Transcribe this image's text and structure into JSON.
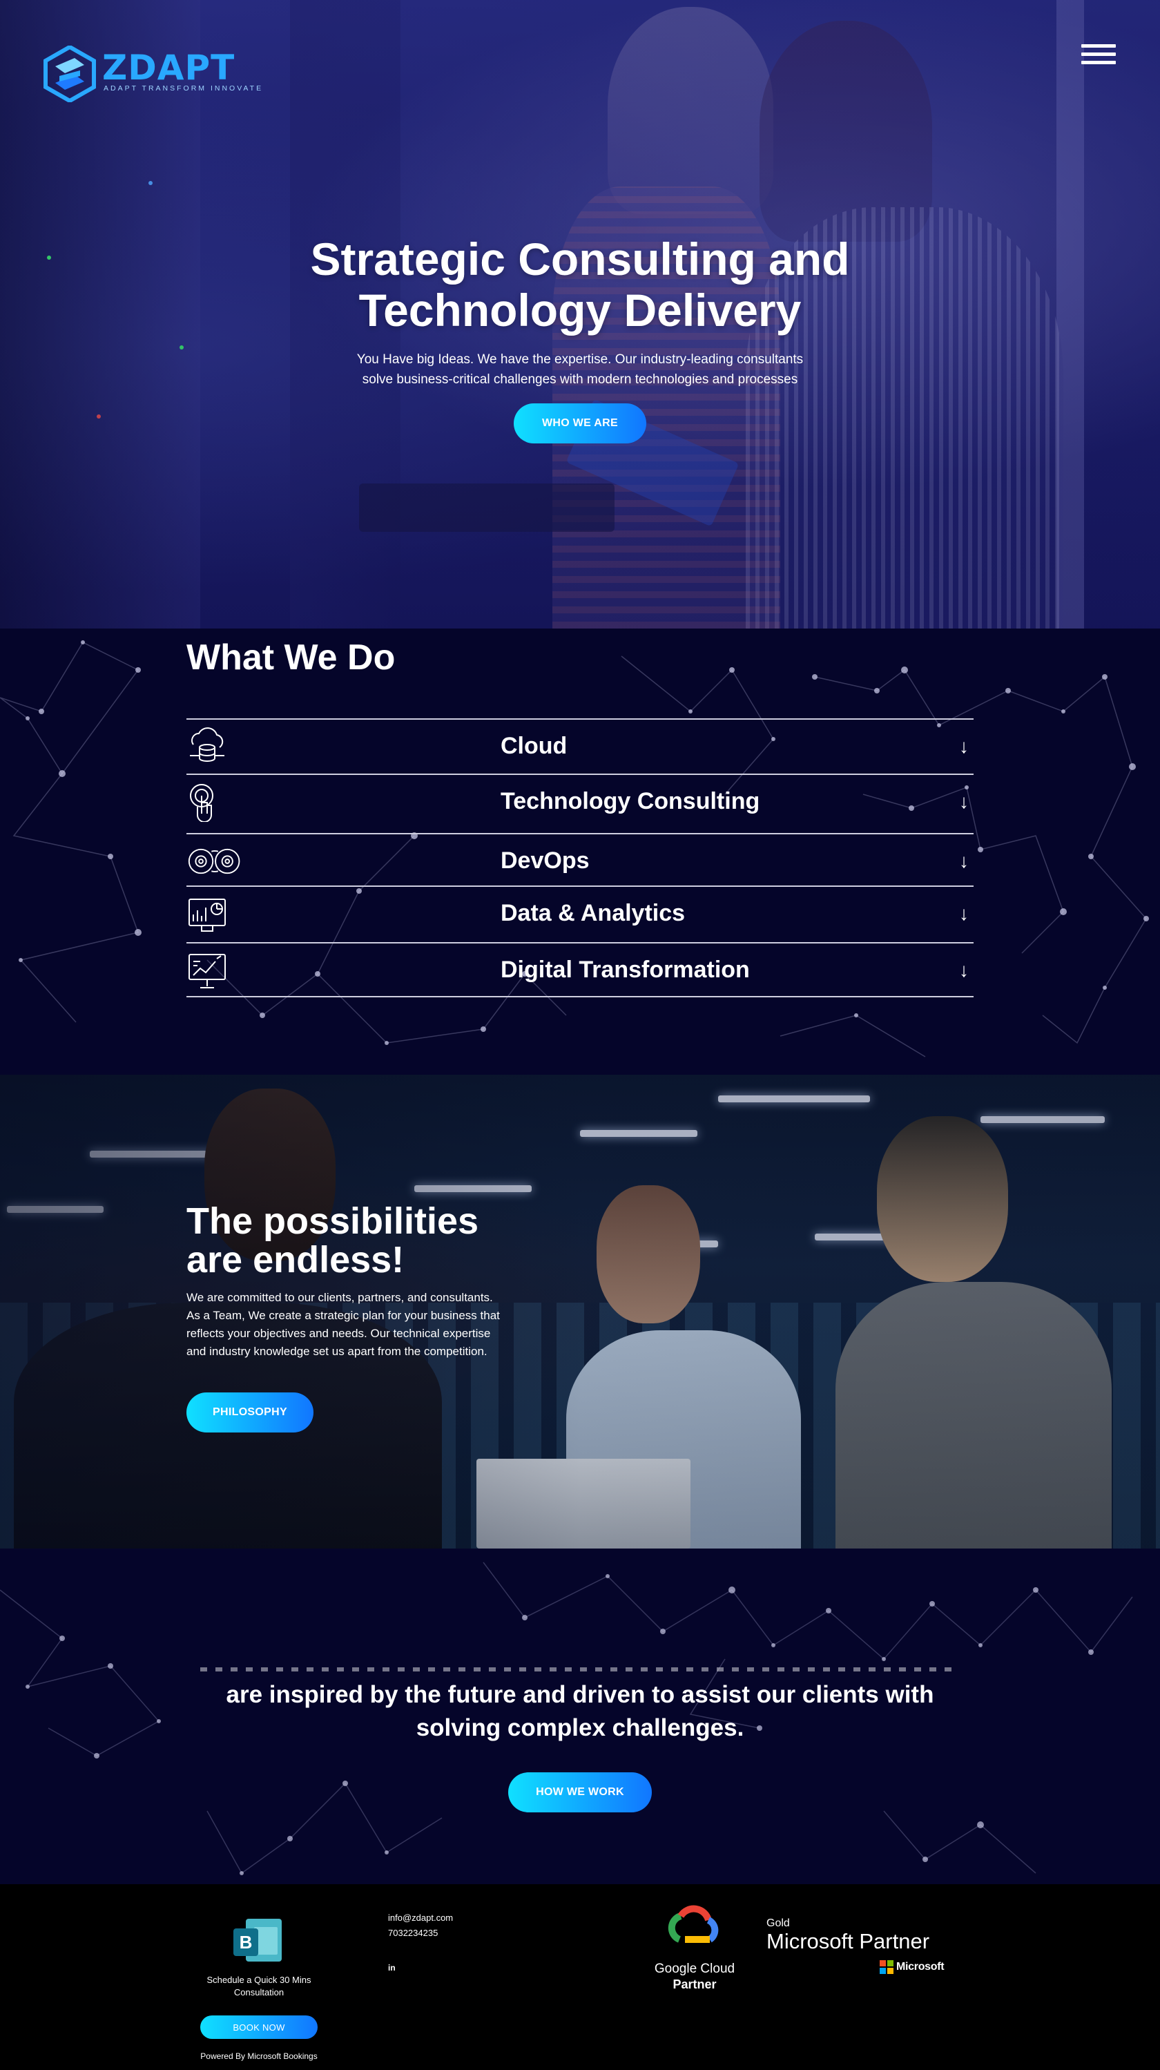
{
  "brand": {
    "name": "ZDAPT",
    "tagline": "ADAPT TRANSFORM INNOVATE",
    "accent_cyan": "#10e0ff",
    "accent_blue": "#1176ff",
    "navy": "#05052a"
  },
  "header": {
    "menu_icon": "hamburger-icon"
  },
  "hero": {
    "title_line1": "Strategic Consulting and",
    "title_line2": "Technology Delivery",
    "subtitle_line1": "You Have big Ideas. We have the expertise. Our industry-leading consultants",
    "subtitle_line2": "solve business-critical challenges with modern technologies and processes",
    "cta": "WHO WE ARE"
  },
  "what_we_do": {
    "title": "What We Do",
    "services": [
      {
        "label": "Cloud",
        "icon": "cloud-database-icon"
      },
      {
        "label": "Technology Consulting",
        "icon": "touch-target-icon"
      },
      {
        "label": "DevOps",
        "icon": "gears-cycle-icon"
      },
      {
        "label": "Data & Analytics",
        "icon": "analytics-dashboard-icon"
      },
      {
        "label": "Digital Transformation",
        "icon": "digital-board-icon"
      }
    ],
    "arrow": "↓"
  },
  "possibilities": {
    "title_line1": "The possibilities",
    "title_line2": "are endless!",
    "text": "We are committed to our clients, partners, and consultants. As a Team, We create a strategic plan for your business that reflects your objectives and needs. Our technical expertise and industry knowledge set us apart from the competition.",
    "cta": "PHILOSOPHY"
  },
  "mission": {
    "line1": "are inspired by the future and driven to assist our clients with",
    "line2": "solving complex challenges.",
    "cta": "HOW WE WORK"
  },
  "footer": {
    "booking_text_line1": "Schedule a Quick 30 Mins",
    "booking_text_line2": "Consultation",
    "book_button": "BOOK NOW",
    "powered_by": "Powered By Microsoft Bookings",
    "email": "info@zdapt.com",
    "phone": "7032234235",
    "social": "in",
    "google_line1": "Google Cloud",
    "google_line2": "Partner",
    "ms_gold": "Gold",
    "ms_partner": "Microsoft Partner",
    "ms_brand": "Microsoft"
  }
}
